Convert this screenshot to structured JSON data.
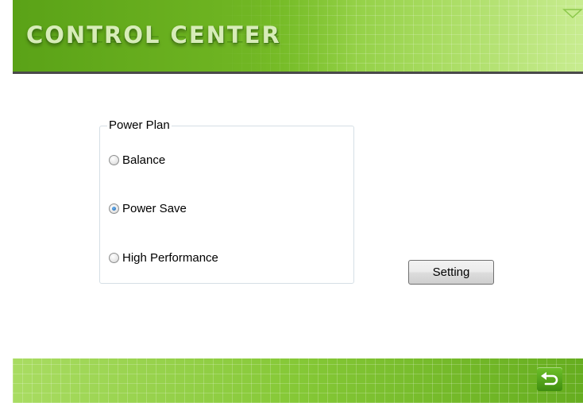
{
  "header": {
    "title": "CONTROL CENTER",
    "menu_icon": "triangle-down-icon"
  },
  "power_plan": {
    "legend": "Power Plan",
    "options": [
      {
        "label": "Balance",
        "checked": false
      },
      {
        "label": "Power Save",
        "checked": true
      },
      {
        "label": "High Performance",
        "checked": false
      }
    ],
    "selected": "Power Save"
  },
  "actions": {
    "setting_label": "Setting"
  },
  "footer": {
    "back_icon": "return-arrow-icon"
  },
  "colors": {
    "accent_green": "#6db321",
    "border_dark": "#4a4a4a"
  }
}
